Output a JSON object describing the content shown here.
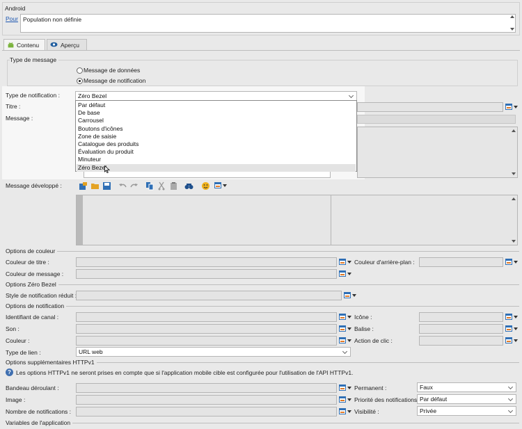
{
  "android": {
    "title": "Android",
    "for_link": "Pour",
    "population_value": "Population non définie"
  },
  "tabs": [
    {
      "label": "Contenu"
    },
    {
      "label": "Aperçu"
    }
  ],
  "message_type": {
    "legend": "Type de message",
    "options": [
      "Message de données",
      "Message de notification"
    ],
    "selected": "Message de notification"
  },
  "form": {
    "notif_type_label": "Type de notification :",
    "notif_type_value": "Zéro Bezel",
    "title_label": "Titre :",
    "message_label": "Message :",
    "expanded_label": "Message développé :"
  },
  "dropdown": {
    "items": [
      "Par défaut",
      "De base",
      "Carrousel",
      "Boutons d'icônes",
      "Zone de saisie",
      "Catalogue des produits",
      "Évaluation du produit",
      "Minuteur",
      "Zéro Bezel"
    ],
    "hovered": "Zéro Bezel"
  },
  "color_options": {
    "legend": "Options de couleur",
    "title_color_label": "Couleur de titre :",
    "bg_color_label": "Couleur d'arrière-plan :",
    "message_color_label": "Couleur de message :"
  },
  "zero_bezel": {
    "legend": "Options Zéro Bezel",
    "reduced_style_label": "Style de notification réduit :"
  },
  "notification_options": {
    "legend": "Options de notification",
    "channel_label": "Identifiant de canal :",
    "icon_label": "Icône :",
    "sound_label": "Son :",
    "tag_label": "Balise :",
    "color_label": "Couleur :",
    "click_action_label": "Action de clic :",
    "link_type_label": "Type de lien :",
    "link_type_value": "URL web"
  },
  "httpv1": {
    "legend": "Options supplémentaires HTTPv1",
    "info": "Les options HTTPv1 ne seront prises en compte que si l'application mobile cible est configurée pour l'utilisation de l'API HTTPv1.",
    "ticker_label": "Bandeau déroulant :",
    "permanent_label": "Permanent :",
    "permanent_value": "Faux",
    "image_label": "Image :",
    "priority_label": "Priorité des notifications :",
    "priority_value": "Par défaut",
    "count_label": "Nombre de notifications :",
    "visibility_label": "Visibilité :",
    "visibility_value": "Privée"
  },
  "app_variables": {
    "legend": "Variables de l'application"
  }
}
